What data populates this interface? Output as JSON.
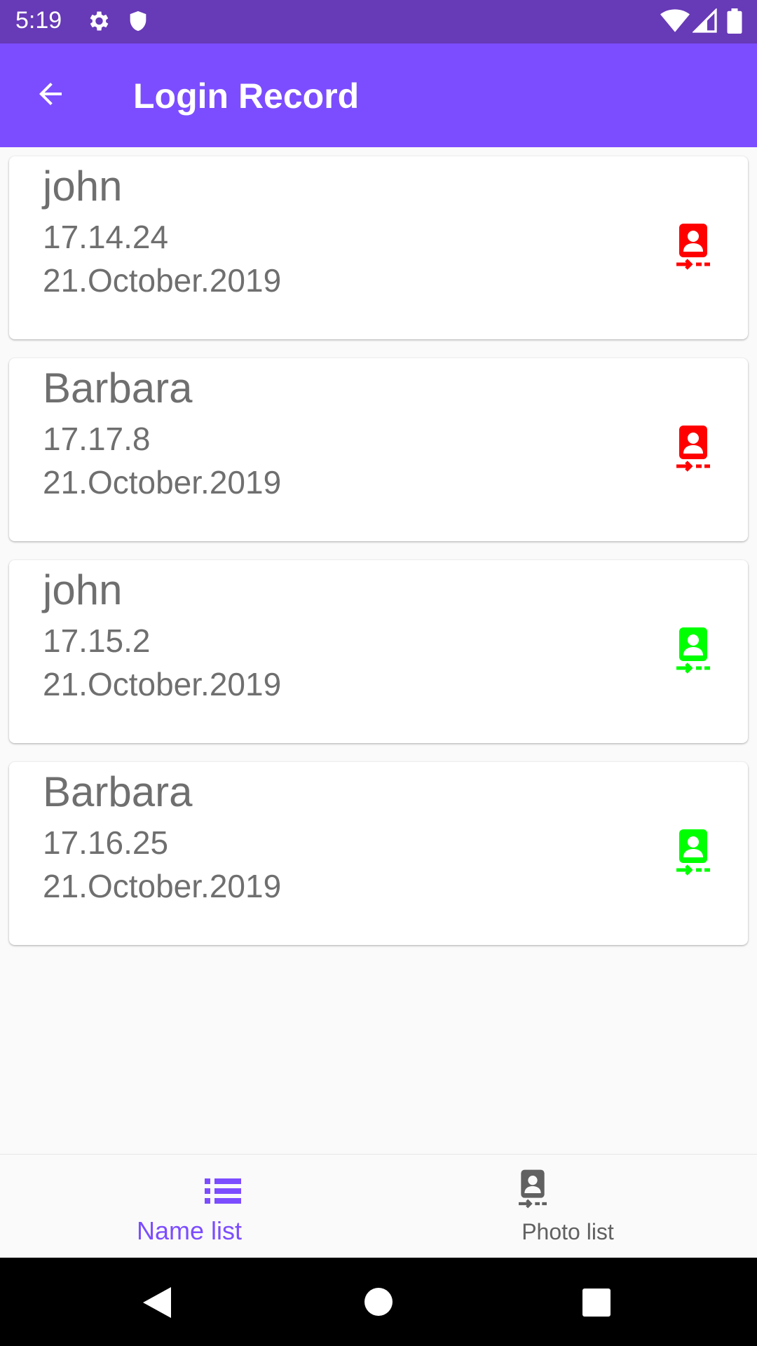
{
  "status_bar": {
    "time": "5:19",
    "icons": [
      "settings-gear-icon",
      "shield-icon",
      "wifi-icon",
      "cell-signal-icon",
      "battery-icon"
    ],
    "background": "#673ab7"
  },
  "app_bar": {
    "title": "Login Record",
    "back_icon": "arrow-back-icon",
    "background": "#7c4dff"
  },
  "records": [
    {
      "name": "john",
      "time": "17.14.24",
      "date": "21.October.2019",
      "status_icon": "login-photo-icon",
      "status_color": "#ff0000"
    },
    {
      "name": "Barbara",
      "time": "17.17.8",
      "date": "21.October.2019",
      "status_icon": "login-photo-icon",
      "status_color": "#ff0000"
    },
    {
      "name": "john",
      "time": "17.15.2",
      "date": "21.October.2019",
      "status_icon": "login-photo-icon",
      "status_color": "#00ff00"
    },
    {
      "name": "Barbara",
      "time": "17.16.25",
      "date": "21.October.2019",
      "status_icon": "login-photo-icon",
      "status_color": "#00ff00"
    }
  ],
  "bottom_nav": {
    "items": [
      {
        "label": "Name list",
        "icon": "list-icon",
        "selected": true,
        "color": "#7c4dff"
      },
      {
        "label": "Photo list",
        "icon": "photo-badge-icon",
        "selected": false,
        "color": "#616161"
      }
    ]
  },
  "system_nav": {
    "icons": [
      "back-triangle-icon",
      "home-circle-icon",
      "recents-square-icon"
    ]
  }
}
